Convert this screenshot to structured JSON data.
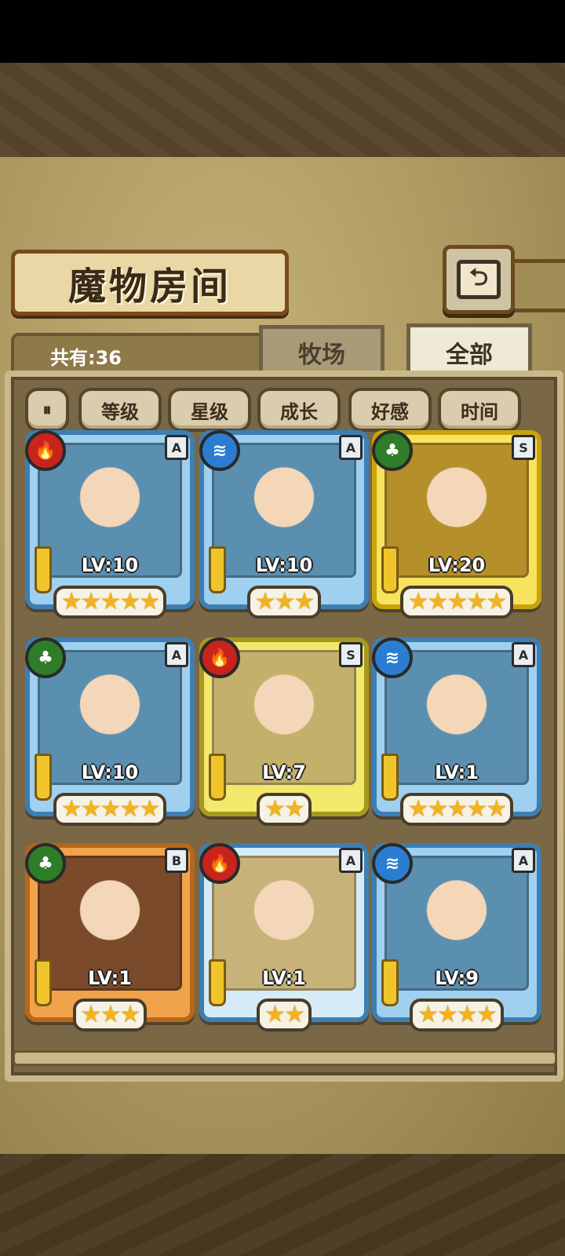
{
  "title": "魔物房间",
  "back_icon": "back-arrow-icon",
  "count_label": "共有:36",
  "tabs": {
    "pasture": "牧场",
    "all": "全部",
    "active": "all"
  },
  "filters": [
    "等级",
    "星级",
    "成长",
    "好感",
    "时间"
  ],
  "filter_toggle_icon": "sort-toggle-icon",
  "cards": [
    {
      "element": "fire",
      "rank": "A",
      "level": "LV:10",
      "stars": 5,
      "frame": "blue"
    },
    {
      "element": "water",
      "rank": "A",
      "level": "LV:10",
      "stars": 3,
      "frame": "blue"
    },
    {
      "element": "grass",
      "rank": "S",
      "level": "LV:20",
      "stars": 5,
      "frame": "gold"
    },
    {
      "element": "grass",
      "rank": "A",
      "level": "LV:10",
      "stars": 5,
      "frame": "blue"
    },
    {
      "element": "fire",
      "rank": "S",
      "level": "LV:7",
      "stars": 2,
      "frame": "gold-plain"
    },
    {
      "element": "water",
      "rank": "A",
      "level": "LV:1",
      "stars": 5,
      "frame": "blue"
    },
    {
      "element": "grass",
      "rank": "B",
      "level": "LV:1",
      "stars": 3,
      "frame": "orange"
    },
    {
      "element": "fire",
      "rank": "A",
      "level": "LV:1",
      "stars": 2,
      "frame": "blue-plain"
    },
    {
      "element": "water",
      "rank": "A",
      "level": "LV:9",
      "stars": 4,
      "frame": "blue"
    }
  ],
  "colors": {
    "fire": "#c8231c",
    "water": "#2b7dd1",
    "grass": "#2f7d29",
    "star": "#f2b321"
  }
}
